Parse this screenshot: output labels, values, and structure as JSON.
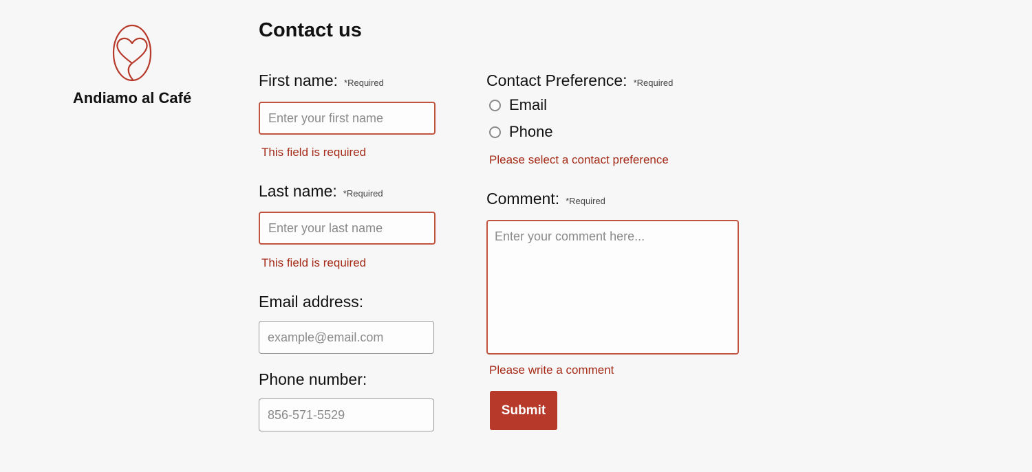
{
  "brand": {
    "name": "Andiamo al Café",
    "logo_icon": "heart-coffee-bean-icon",
    "accent_color": "#b7392a"
  },
  "page": {
    "title": "Contact us"
  },
  "form": {
    "required_marker": "*Required",
    "first_name": {
      "label": "First name:",
      "placeholder": "Enter your first name",
      "value": "",
      "error": "This field is required"
    },
    "last_name": {
      "label": "Last name:",
      "placeholder": "Enter your last name",
      "value": "",
      "error": "This field is required"
    },
    "email": {
      "label": "Email address:",
      "placeholder": "example@email.com",
      "value": ""
    },
    "phone": {
      "label": "Phone number:",
      "placeholder": "856-571-5529",
      "value": ""
    },
    "contact_preference": {
      "label": "Contact Preference:",
      "options": [
        {
          "label": "Email",
          "selected": false
        },
        {
          "label": "Phone",
          "selected": false
        }
      ],
      "error": "Please select a contact preference"
    },
    "comment": {
      "label": "Comment:",
      "placeholder": "Enter your comment here...",
      "value": "",
      "error": "Please write a comment"
    },
    "submit_label": "Submit",
    "error_color": "#a52a18"
  }
}
